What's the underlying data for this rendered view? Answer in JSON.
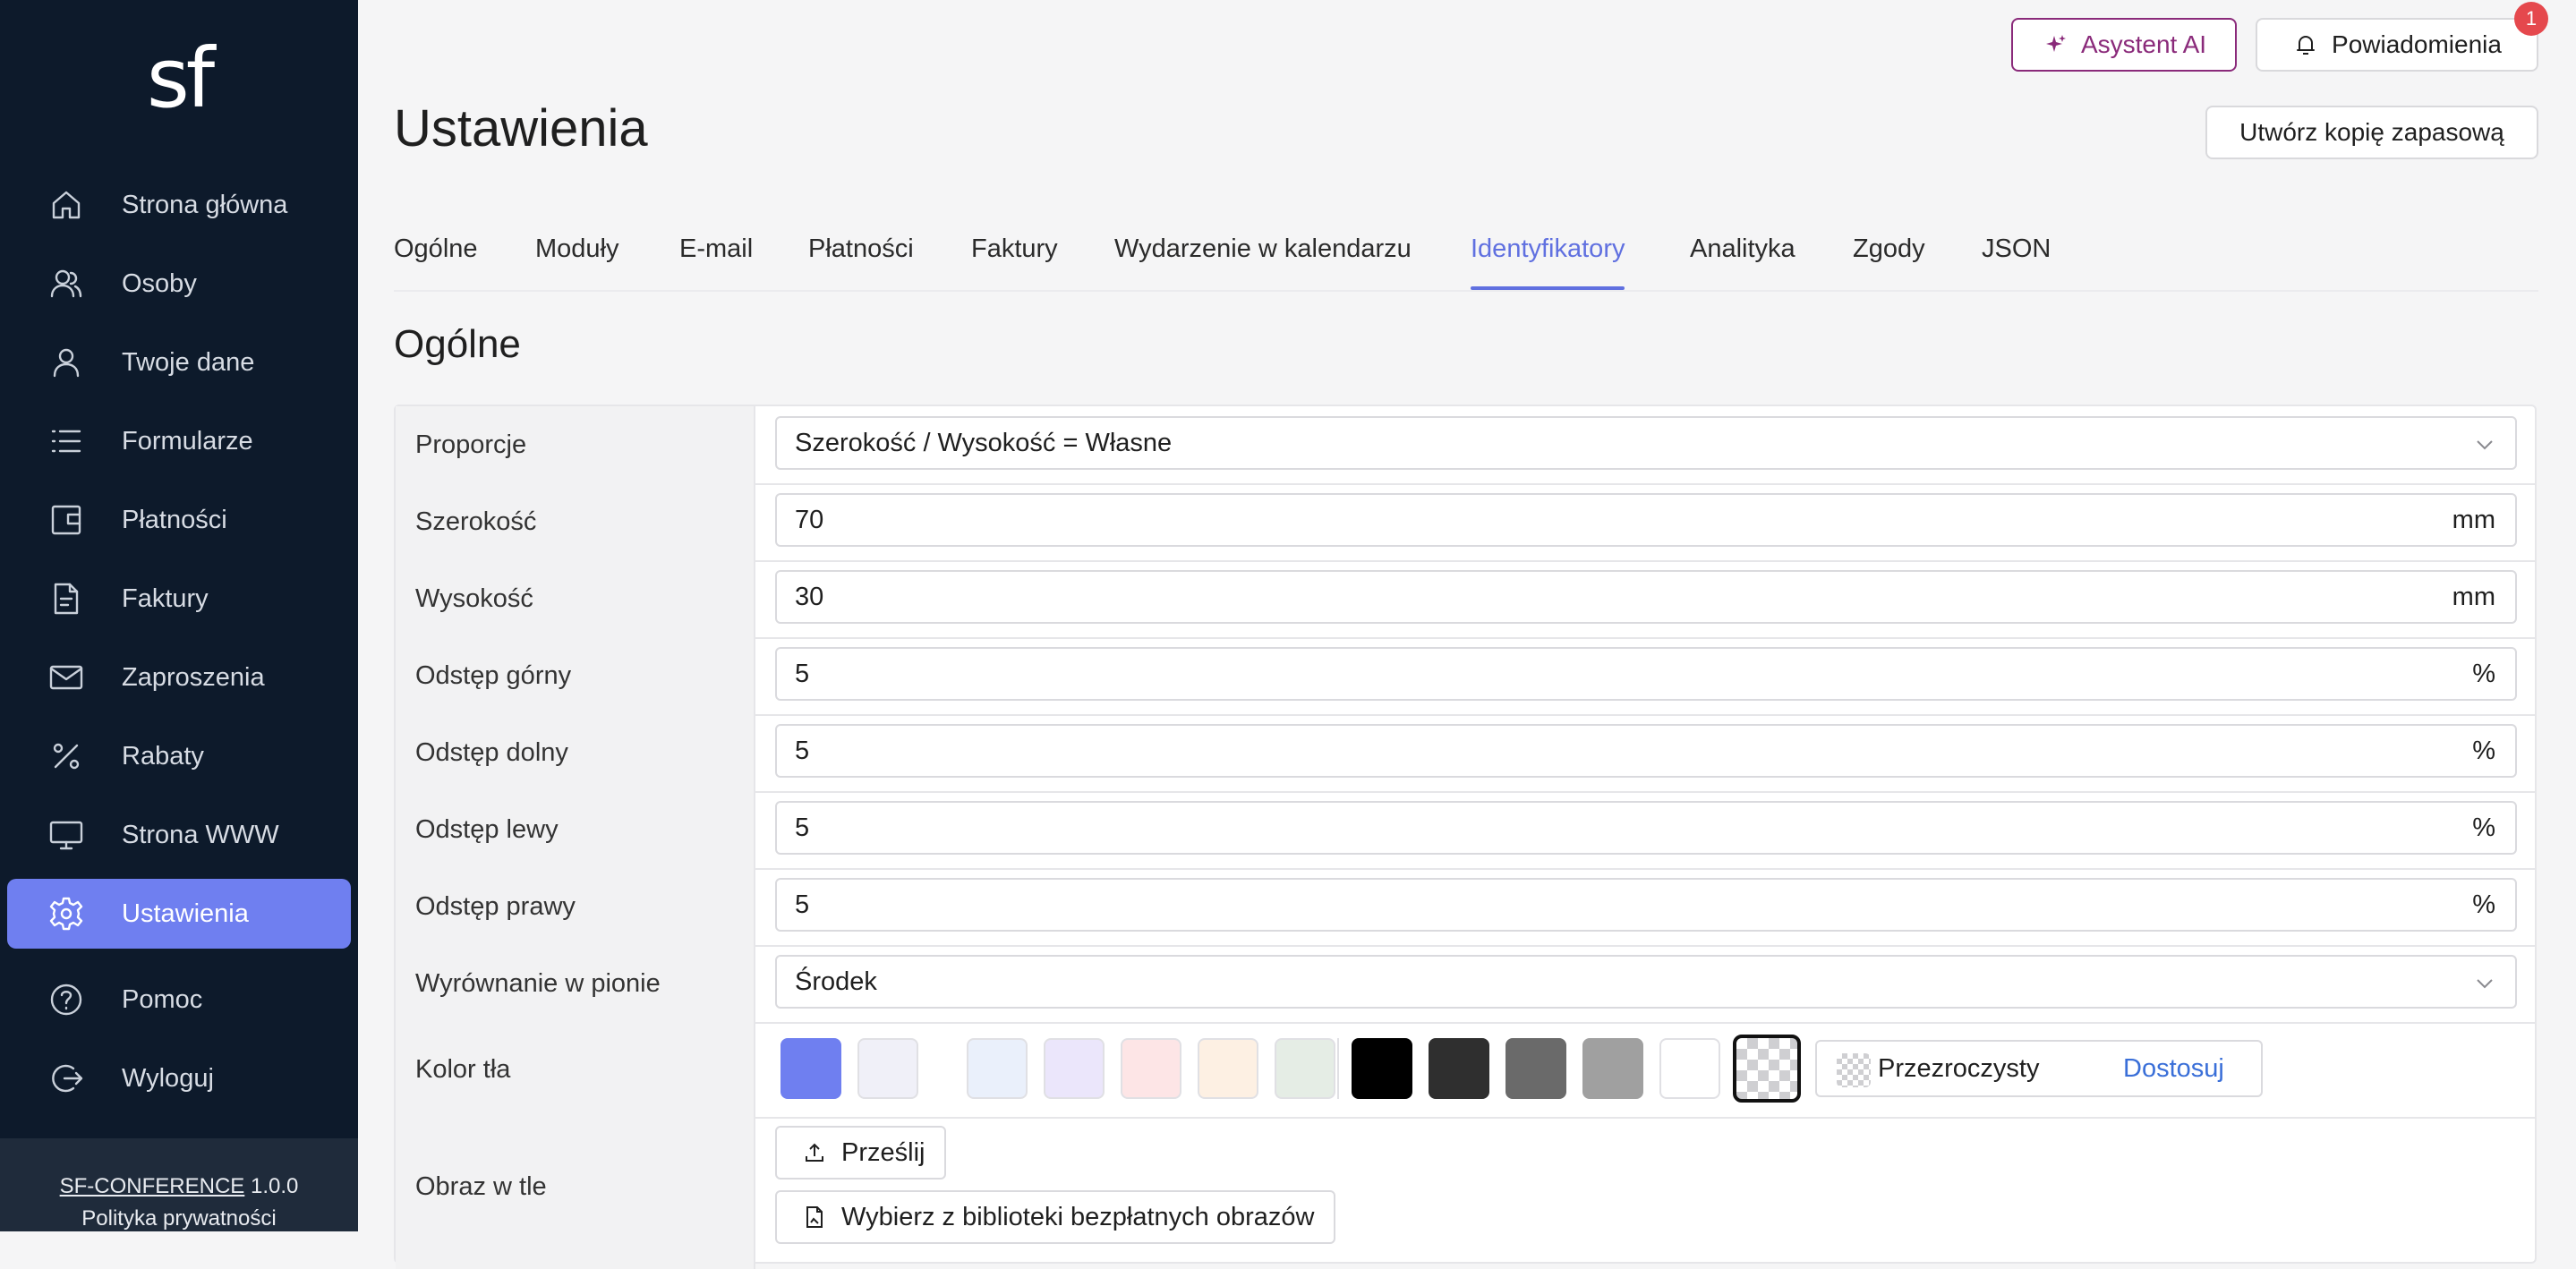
{
  "sidebar": {
    "logo": "sf",
    "items": [
      {
        "label": "Strona główna",
        "icon": "home-icon"
      },
      {
        "label": "Osoby",
        "icon": "people-icon"
      },
      {
        "label": "Twoje dane",
        "icon": "user-icon"
      },
      {
        "label": "Formularze",
        "icon": "list-icon"
      },
      {
        "label": "Płatności",
        "icon": "wallet-icon"
      },
      {
        "label": "Faktury",
        "icon": "document-icon"
      },
      {
        "label": "Zaproszenia",
        "icon": "envelope-icon"
      },
      {
        "label": "Rabaty",
        "icon": "percent-icon"
      },
      {
        "label": "Strona WWW",
        "icon": "monitor-icon"
      },
      {
        "label": "Ustawienia",
        "icon": "gear-icon",
        "active": true
      },
      {
        "label": "Pomoc",
        "icon": "help-icon"
      },
      {
        "label": "Wyloguj",
        "icon": "logout-icon"
      }
    ],
    "footer": {
      "product": "SF-CONFERENCE",
      "version": "1.0.0",
      "privacy": "Polityka prywatności"
    }
  },
  "header": {
    "ai_button": "Asystent AI",
    "notifications_button": "Powiadomienia",
    "notifications_count": "1",
    "backup_button": "Utwórz kopię zapasową"
  },
  "page": {
    "title": "Ustawienia",
    "tabs": [
      {
        "label": "Ogólne"
      },
      {
        "label": "Moduły"
      },
      {
        "label": "E-mail"
      },
      {
        "label": "Płatności"
      },
      {
        "label": "Faktury"
      },
      {
        "label": "Wydarzenie w kalendarzu"
      },
      {
        "label": "Identyfikatory",
        "active": true
      },
      {
        "label": "Analityka"
      },
      {
        "label": "Zgody"
      },
      {
        "label": "JSON"
      }
    ],
    "section_title": "Ogólne"
  },
  "form": {
    "proportions": {
      "label": "Proporcje",
      "value": "Szerokość / Wysokość = Własne"
    },
    "width": {
      "label": "Szerokość",
      "value": "70",
      "unit": "mm"
    },
    "height": {
      "label": "Wysokość",
      "value": "30",
      "unit": "mm"
    },
    "margin_top": {
      "label": "Odstęp górny",
      "value": "5",
      "unit": "%"
    },
    "margin_bottom": {
      "label": "Odstęp dolny",
      "value": "5",
      "unit": "%"
    },
    "margin_left": {
      "label": "Odstęp lewy",
      "value": "5",
      "unit": "%"
    },
    "margin_right": {
      "label": "Odstęp prawy",
      "value": "5",
      "unit": "%"
    },
    "vertical_align": {
      "label": "Wyrównanie w pionie",
      "value": "Środek"
    },
    "bg_color": {
      "label": "Kolor tła",
      "swatches": [
        "#6f7ff0",
        "#f0f0f8",
        "#eaf0fb",
        "#ebe6fb",
        "#fde5e6",
        "#fdf0e3",
        "#e5ede5",
        "#000000",
        "#2f2f2f",
        "#6a6a6a",
        "#a0a0a0",
        "#ffffff",
        "transparent"
      ],
      "selected": "transparent",
      "current_label": "Przezroczysty",
      "customize_link": "Dostosuj"
    },
    "bg_image": {
      "label": "Obraz w tle",
      "upload_button": "Prześlij",
      "library_button": "Wybierz z biblioteki bezpłatnych obrazów"
    }
  }
}
